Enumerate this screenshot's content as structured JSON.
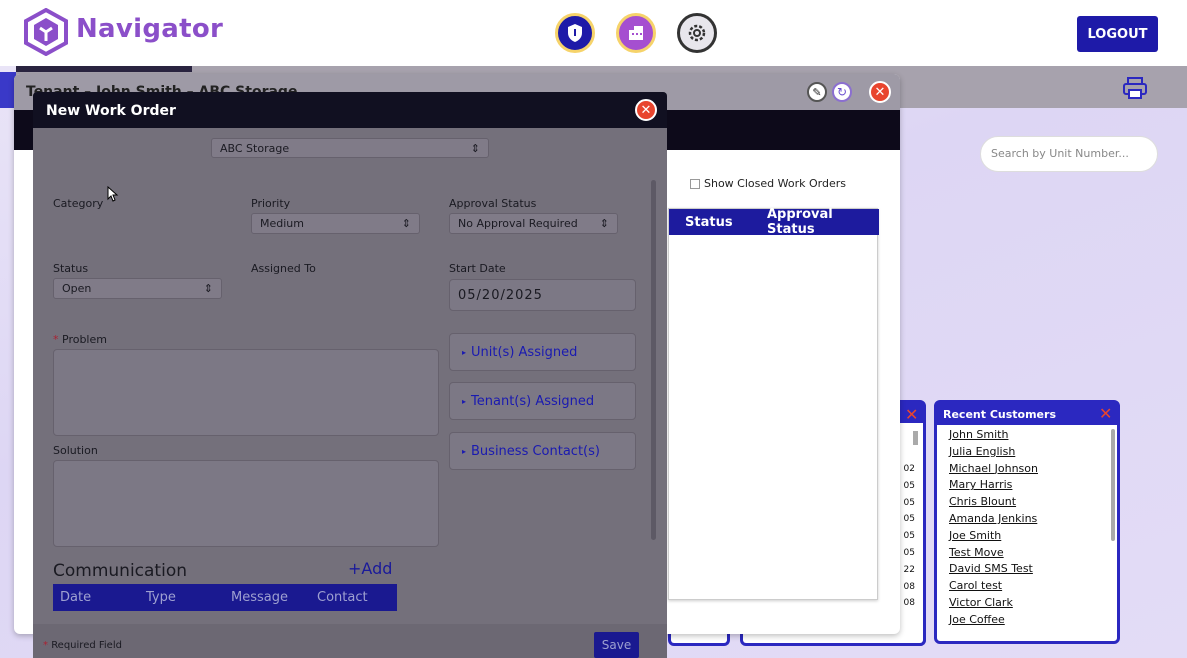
{
  "app": {
    "brand": "Navigator",
    "logout_label": "LOGOUT"
  },
  "colors": {
    "brand_purple": "#8b4fc9",
    "primary_blue": "#1e1aa8",
    "close_red": "#e8452e"
  },
  "icons": {
    "shield": "shield-icon",
    "building": "building-icon",
    "gear": "gear-icon",
    "print": "printer-icon",
    "paperclip": "paperclip-icon",
    "refresh": "refresh-icon",
    "close": "close-icon"
  },
  "search": {
    "placeholder": "Search by Unit Number..."
  },
  "tenant_panel": {
    "title": "Tenant – John Smith – ABC Storage",
    "show_closed_label": "Show Closed Work Orders",
    "columns": [
      "Status",
      "Approval Status"
    ]
  },
  "units_widget": {
    "values": [
      "02",
      "05",
      "05",
      "05",
      "05",
      "05",
      "22",
      "08",
      "08"
    ]
  },
  "recent_customers": {
    "title": "Recent Customers",
    "items": [
      "John Smith",
      "Julia English",
      "Michael Johnson",
      "Mary Harris",
      "Chris Blount",
      "Amanda Jenkins",
      "Joe Smith",
      "Test Move",
      "David SMS Test",
      "Carol test",
      "Victor Clark",
      "Joe Coffee"
    ]
  },
  "modal": {
    "title": "New Work Order",
    "facility": "ABC Storage",
    "category_label": "Category",
    "priority_label": "Priority",
    "priority_value": "Medium",
    "approval_label": "Approval Status",
    "approval_value": "No Approval Required",
    "status_label": "Status",
    "status_value": "Open",
    "assigned_label": "Assigned To",
    "start_date_label": "Start Date",
    "start_date_value": "05/20/2025",
    "problem_label": "Problem",
    "solution_label": "Solution",
    "units_assigned": "Unit(s) Assigned",
    "tenants_assigned": "Tenant(s) Assigned",
    "business_contacts": "Business Contact(s)",
    "communication_label": "Communication",
    "add_label": "+Add",
    "comm_columns": [
      "Date",
      "Type",
      "Message",
      "Contact"
    ],
    "required_note": "Required Field",
    "save_label": "Save"
  }
}
